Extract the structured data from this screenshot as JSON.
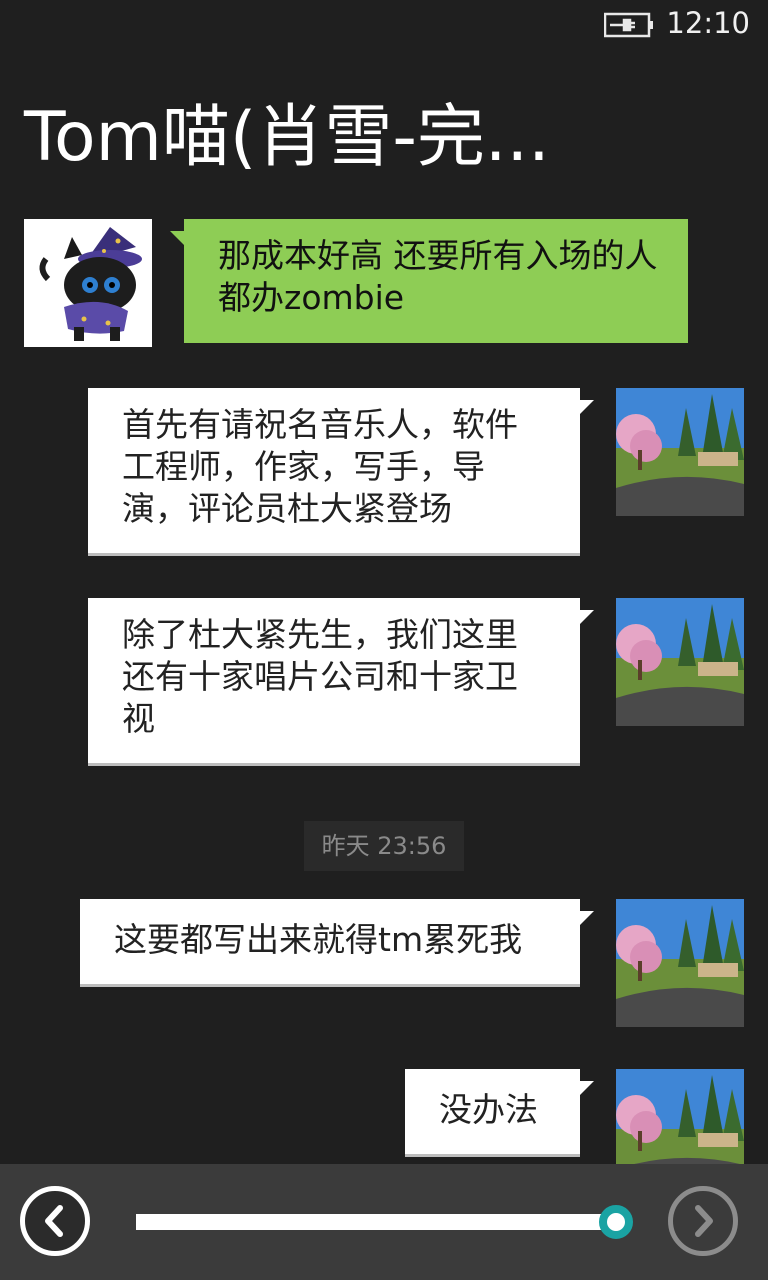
{
  "status_bar": {
    "time": "12:10",
    "battery_icon": "battery-charging-icon"
  },
  "header": {
    "title": "Tom喵(肖雪-完..."
  },
  "messages": [
    {
      "direction": "incoming",
      "avatar_icon": "black-cat-wizard-avatar",
      "text": "那成本好高 还要所有入场的人都办zombie"
    },
    {
      "direction": "outgoing",
      "avatar_icon": "landscape-photo-avatar",
      "text": "首先有请祝名音乐人，软件工程师，作家，写手，导演，评论员杜大紧登场"
    },
    {
      "direction": "outgoing",
      "avatar_icon": "landscape-photo-avatar",
      "text": "除了杜大紧先生，我们这里还有十家唱片公司和十家卫视"
    },
    {
      "direction": "outgoing",
      "avatar_icon": "landscape-photo-avatar",
      "text": "这要都写出来就得tm累死我"
    },
    {
      "direction": "outgoing",
      "avatar_icon": "landscape-photo-avatar",
      "text": "没办法"
    }
  ],
  "timestamp": "昨天 23:56",
  "player": {
    "prev_icon": "chevron-left-icon",
    "next_icon": "chevron-right-icon",
    "progress": 1.0,
    "colors": {
      "thumb_ring": "#1aa3a3",
      "incoming_bubble": "#8ecd55",
      "outgoing_bubble": "#ffffff"
    }
  }
}
